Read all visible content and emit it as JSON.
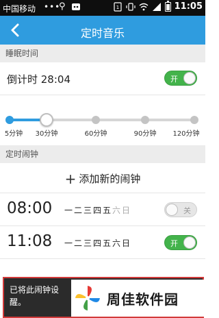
{
  "status_bar": {
    "carrier": "中国移动",
    "dots": "•••",
    "time": "11:05"
  },
  "nav": {
    "title": "定时音乐",
    "back_icon": "chevron-left-icon"
  },
  "sleep_section": {
    "header": "睡眠时间",
    "countdown": "倒计时 28:04",
    "toggle_label": "开",
    "toggle_on": true
  },
  "slider": {
    "labels": [
      "5分钟",
      "30分钟",
      "60分钟",
      "90分钟",
      "120分钟"
    ],
    "selected": "30分钟"
  },
  "alarm_section": {
    "header": "定时闹钟",
    "add_label": "添加新的闹钟"
  },
  "alarms": [
    {
      "time": "08:00",
      "days": [
        "一",
        "二",
        "三",
        "四",
        "五",
        "六",
        "日"
      ],
      "days_active": [
        true,
        true,
        true,
        true,
        true,
        false,
        false
      ],
      "toggle_label": "关",
      "enabled": false
    },
    {
      "time": "11:08",
      "days": [
        "一",
        "二",
        "三",
        "四",
        "五",
        "六",
        "日"
      ],
      "days_active": [
        true,
        true,
        true,
        true,
        true,
        true,
        true
      ],
      "toggle_label": "开",
      "enabled": true
    }
  ],
  "toast": {
    "text": "已将此闹钟设",
    "text_line2": "醒。"
  },
  "watermark": {
    "text": "周佳软件园"
  },
  "colors": {
    "accent": "#2f9cdf",
    "toggle_on": "#43b34b",
    "status_bar": "#0e0e0e"
  }
}
